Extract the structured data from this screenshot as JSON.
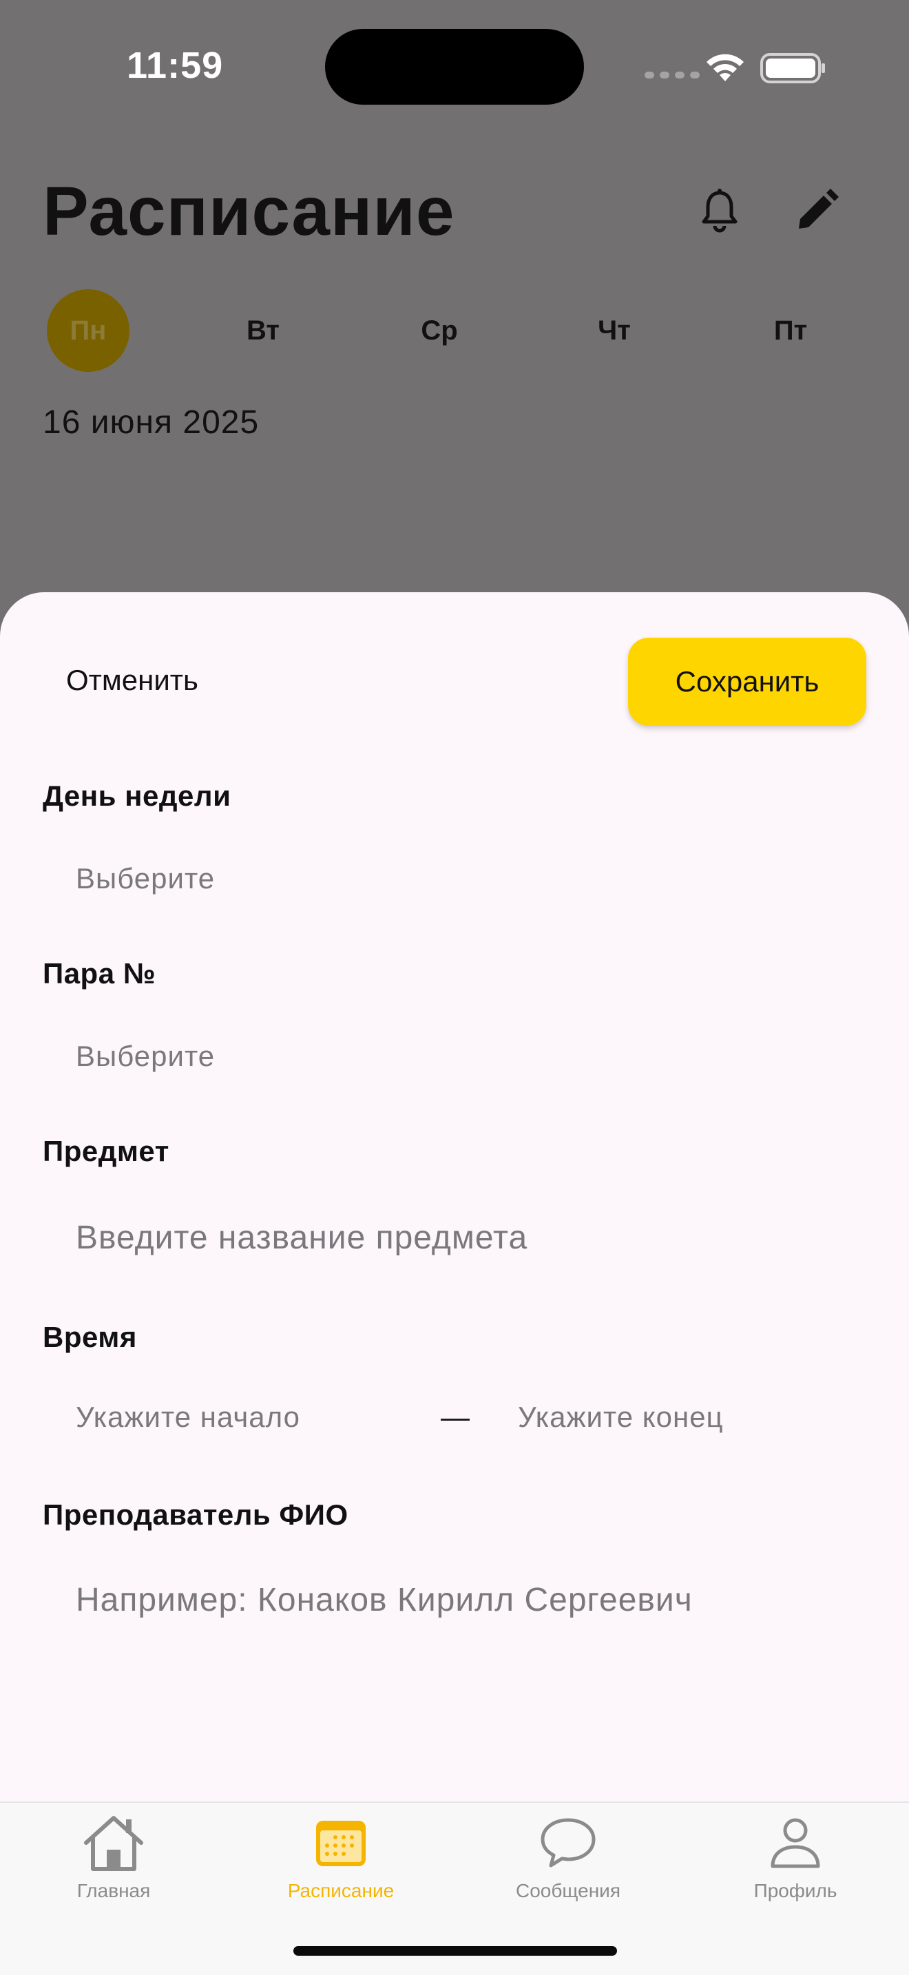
{
  "status_bar": {
    "time": "11:59"
  },
  "header": {
    "title": "Расписание"
  },
  "days": [
    {
      "label": "Пн",
      "active": true
    },
    {
      "label": "Вт",
      "active": false
    },
    {
      "label": "Ср",
      "active": false
    },
    {
      "label": "Чт",
      "active": false
    },
    {
      "label": "Пт",
      "active": false
    }
  ],
  "date": "16 июня 2025",
  "sheet": {
    "cancel_label": "Отменить",
    "save_label": "Сохранить",
    "weekday": {
      "label": "День недели",
      "placeholder": "Выберите"
    },
    "pair": {
      "label": "Пара №",
      "placeholder": "Выберите"
    },
    "subject": {
      "label": "Предмет",
      "placeholder": "Введите название предмета"
    },
    "time": {
      "label": "Время",
      "start_placeholder": "Укажите начало",
      "separator": "—",
      "end_placeholder": "Укажите конец"
    },
    "teacher": {
      "label": "Преподаватель ФИО",
      "placeholder": "Например: Конаков Кирилл Сергеевич"
    }
  },
  "tabbar": {
    "items": [
      {
        "label": "Главная",
        "icon": "home-icon",
        "active": false
      },
      {
        "label": "Расписание",
        "icon": "calendar-icon",
        "active": true
      },
      {
        "label": "Сообщения",
        "icon": "chat-bubble-icon",
        "active": false
      },
      {
        "label": "Профиль",
        "icon": "person-icon",
        "active": false
      }
    ]
  },
  "colors": {
    "accent": "#ffd500",
    "tab_active": "#f5b400",
    "sheet_bg": "#fdf6fb",
    "overlay": "#737072"
  }
}
